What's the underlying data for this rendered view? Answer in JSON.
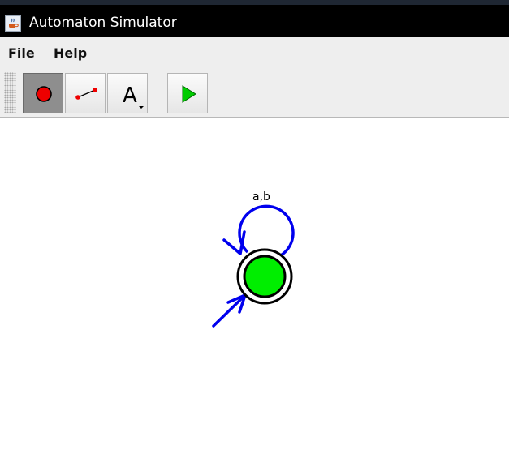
{
  "window": {
    "title": "Automaton Simulator",
    "app_icon": "java-cup-icon"
  },
  "menubar": {
    "items": [
      {
        "label": "File"
      },
      {
        "label": "Help"
      }
    ]
  },
  "toolbar": {
    "tools": [
      {
        "icon": "state-tool-icon",
        "selected": true
      },
      {
        "icon": "transition-tool-icon",
        "selected": false
      },
      {
        "icon": "text-tool-icon",
        "label": "A",
        "selected": false
      },
      {
        "icon": "run-icon",
        "selected": false
      }
    ]
  },
  "automaton": {
    "states": [
      {
        "initial": true,
        "accepting": true,
        "active": true
      }
    ],
    "transitions": [
      {
        "label": "a,b",
        "loop": true
      }
    ]
  },
  "colors": {
    "titlebar": "#000000",
    "menubar": "#eeeeee",
    "state_fill": "#00ee00",
    "arrow": "#0000ee",
    "record_dot": "#ee0000",
    "play": "#00cc00"
  }
}
